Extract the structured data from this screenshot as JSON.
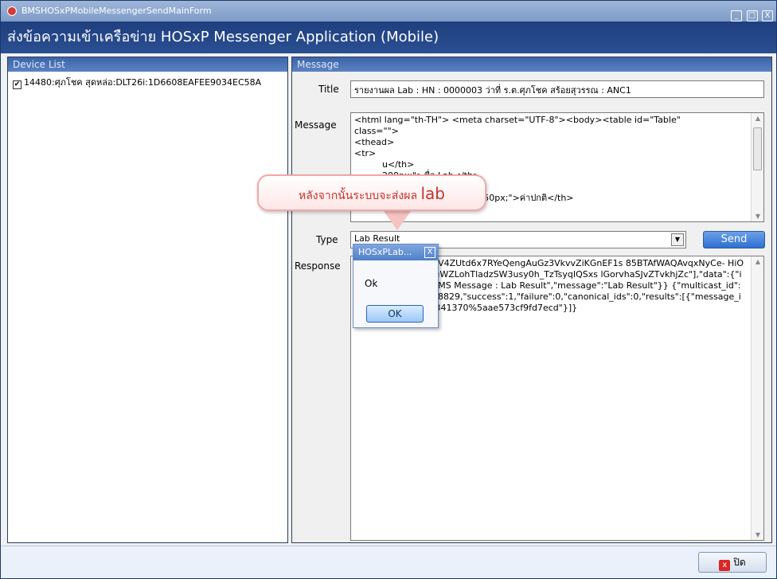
{
  "window": {
    "title": "BMSHOSxPMobileMessengerSendMainForm",
    "controls": [
      "_",
      "□",
      "X"
    ]
  },
  "banner": {
    "title": "ส่งข้อความเข้าเครือข่าย HOSxP Messenger Application (Mobile)"
  },
  "device_list": {
    "header": "Device List",
    "items": [
      {
        "checked": true,
        "label": "14480:ศุภโชค สุดหล่อ:DLT26i:1D6608EAFEE9034EC58A"
      }
    ]
  },
  "message_panel": {
    "header": "Message",
    "title_label": "Title",
    "title_value": "รายงานผล Lab : HN : 0000003 ว่าที่ ร.ต.ศุภโชค สร้อยสุวรรณ : ANC1",
    "message_label": "Message",
    "message_lines": [
      "<html lang=\"th-TH\"> <meta charset=\"UTF-8\"><body><table id=\"Table\"",
      "class=\"\">",
      "<thead>",
      "<tr>",
      "          u</th>",
      "          200px;\">ชื่อ Lab</th>",
      "          100px;\">ผล</th>",
      "<th align=\"\" style=\" width: 150px;\">ค่าปกติ</th>"
    ],
    "type_label": "Type",
    "type_value": "Lab Result",
    "send_label": "Send",
    "response_label": "Response",
    "response_text": "                          :  VNBn_OfiiAXKSvCV4ZUtd6x7RYeQengAuGz3VkvvZiKGnEF1s 85BTAfWAQAvqxNyCe- HiOJS0jo6gek8NZ7M0uWZLohTladzSW3usy0h_TzTsyqIQSxs lGorvhaSJvZTvkhjZc\"],\"data\":{\"id\":\"1119\",\"title\":\"BMS Message : Lab Result\",\"message\":\"Lab Result\"}} {\"multicast_id\":6518082373768538829,\"success\":1,\"failure\":0,\"canonical_ids\":0,\"results\":[{\"message_id\":\"0:1423043164341370%5aae573cf9fd7ecd\"}]}"
  },
  "callout": {
    "text_main": "หลังจากนั้นระบบจะส่งผล",
    "text_big": "lab"
  },
  "dialog": {
    "title": "HOSxPLab...",
    "close": "X",
    "message": "Ok",
    "ok_label": "OK"
  },
  "footer": {
    "close_label": "ปิด",
    "close_icon": "x"
  },
  "colors": {
    "banner_bg": "#1f3f7f",
    "panel_header": "#3b64a8",
    "callout_text": "#c3342c",
    "send_btn": "#2f6fd0"
  }
}
